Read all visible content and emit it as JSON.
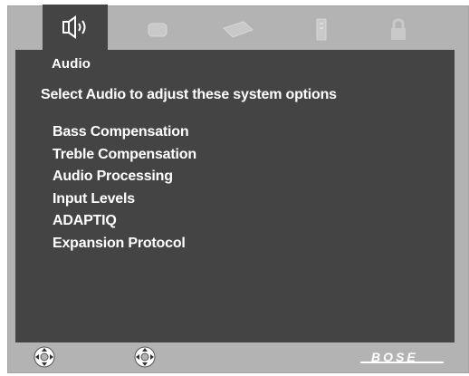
{
  "tabs": [
    {
      "id": "audio",
      "icon": "speaker-icon",
      "active": true
    },
    {
      "id": "video",
      "icon": "display-icon",
      "active": false
    },
    {
      "id": "remote",
      "icon": "remote-icon",
      "active": false
    },
    {
      "id": "settings",
      "icon": "device-icon",
      "active": false
    },
    {
      "id": "lock",
      "icon": "lock-icon",
      "active": false
    }
  ],
  "active_tab_label": "Audio",
  "heading": "Select Audio to adjust these system options",
  "menu_items": [
    "Bass Compensation",
    "Treble Compensation",
    "Audio Processing",
    "Input Levels",
    "ADAPTIQ",
    "Expansion Protocol"
  ],
  "footer": {
    "nav_icons": [
      "four-way-nav-icon",
      "four-way-nav-icon"
    ],
    "brand_logo": "BOSE"
  },
  "colors": {
    "frame": "#b3b3b3",
    "screen": "#444444",
    "text": "#ffffff",
    "inactive_icon": "#c4c4c4"
  }
}
